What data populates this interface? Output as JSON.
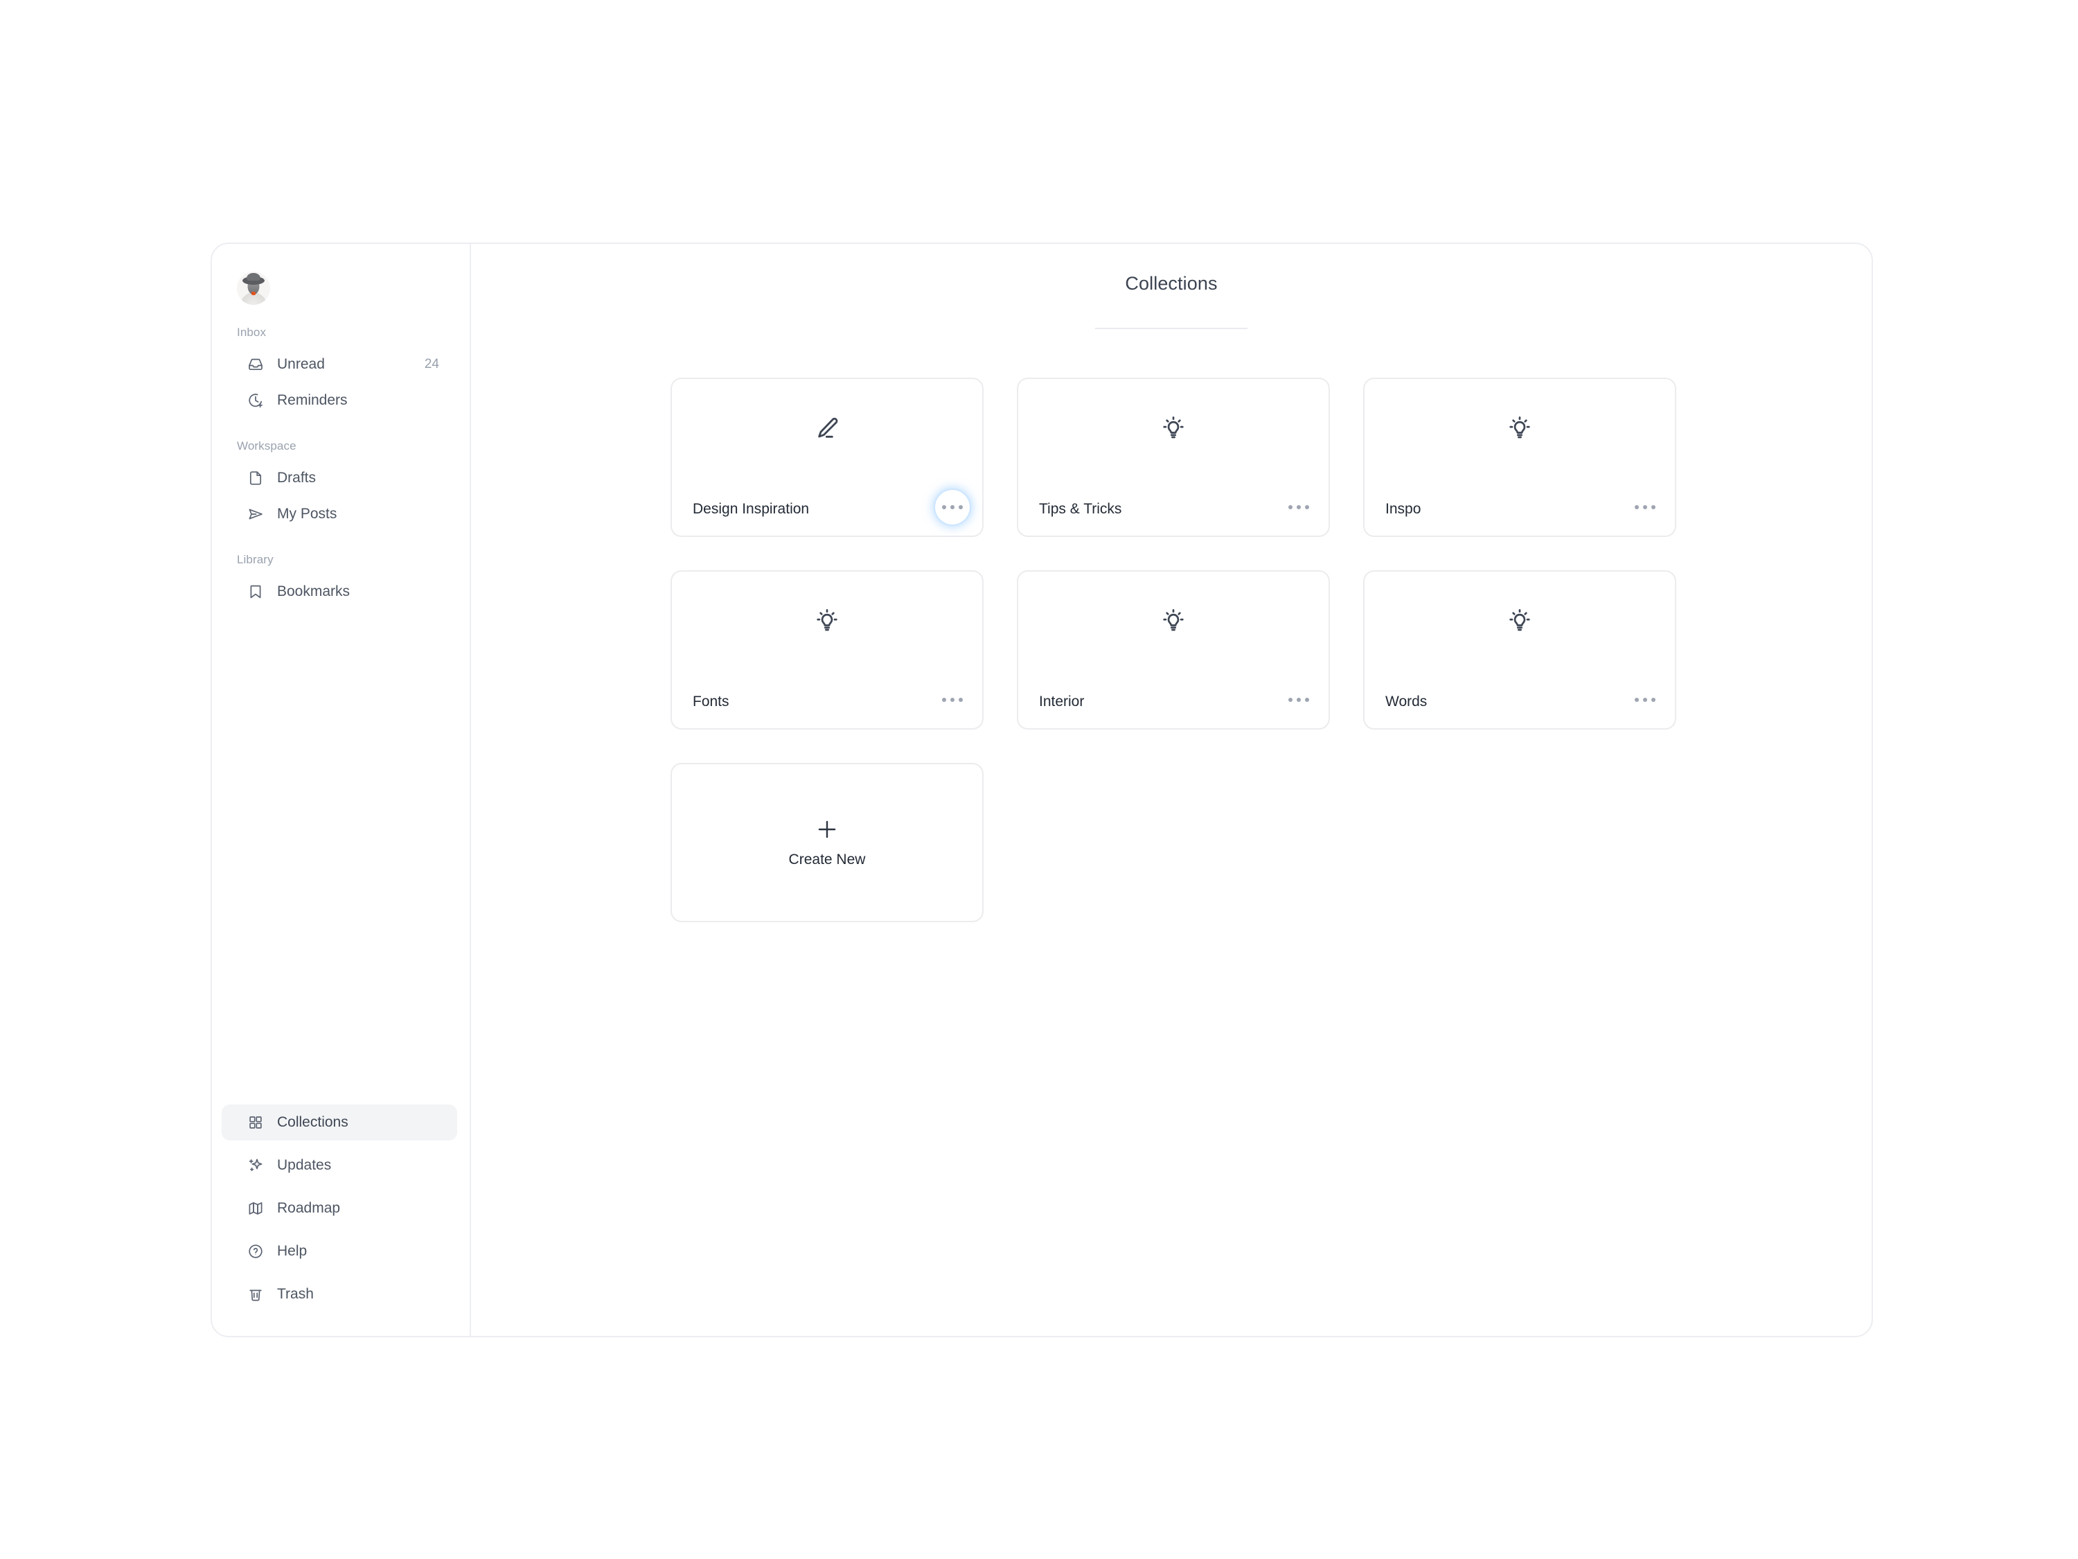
{
  "app": {
    "title": "Collections"
  },
  "sidebar": {
    "avatar_name": "user-avatar",
    "sections": [
      {
        "label": "Inbox",
        "items": [
          {
            "label": "Unread",
            "icon": "inbox-icon",
            "count": "24"
          },
          {
            "label": "Reminders",
            "icon": "clock-plus-icon",
            "count": ""
          }
        ]
      },
      {
        "label": "Workspace",
        "items": [
          {
            "label": "Drafts",
            "icon": "file-icon",
            "count": ""
          },
          {
            "label": "My Posts",
            "icon": "send-icon",
            "count": ""
          }
        ]
      },
      {
        "label": "Library",
        "items": [
          {
            "label": "Bookmarks",
            "icon": "bookmark-icon",
            "count": ""
          }
        ]
      }
    ],
    "footer_items": [
      {
        "label": "Collections",
        "icon": "grid-icon",
        "active": true
      },
      {
        "label": "Updates",
        "icon": "sparkles-icon",
        "active": false
      },
      {
        "label": "Roadmap",
        "icon": "map-icon",
        "active": false
      },
      {
        "label": "Help",
        "icon": "question-circle-icon",
        "active": false
      },
      {
        "label": "Trash",
        "icon": "trash-icon",
        "active": false
      }
    ]
  },
  "main": {
    "cards": [
      {
        "label": "Design Inspiration",
        "icon": "pencil-icon",
        "more_label": "more-options",
        "focused": true
      },
      {
        "label": "Tips & Tricks",
        "icon": "lightbulb-icon",
        "more_label": "more-options",
        "focused": false
      },
      {
        "label": "Inspo",
        "icon": "lightbulb-icon",
        "more_label": "more-options",
        "focused": false
      },
      {
        "label": "Fonts",
        "icon": "lightbulb-icon",
        "more_label": "more-options",
        "focused": false
      },
      {
        "label": "Interior",
        "icon": "lightbulb-icon",
        "more_label": "more-options",
        "focused": false
      },
      {
        "label": "Words",
        "icon": "lightbulb-icon",
        "more_label": "more-options",
        "focused": false
      }
    ],
    "create_card": {
      "label": "Create New",
      "icon": "plus-icon"
    }
  },
  "colors": {
    "accent_focus": "#74b9ff",
    "text_primary": "#232a35",
    "text_secondary": "#4d5562",
    "text_muted": "#9aa2ae",
    "border": "#ececef",
    "active_bg": "#f3f4f6",
    "badge_orange": "#e2541f"
  }
}
